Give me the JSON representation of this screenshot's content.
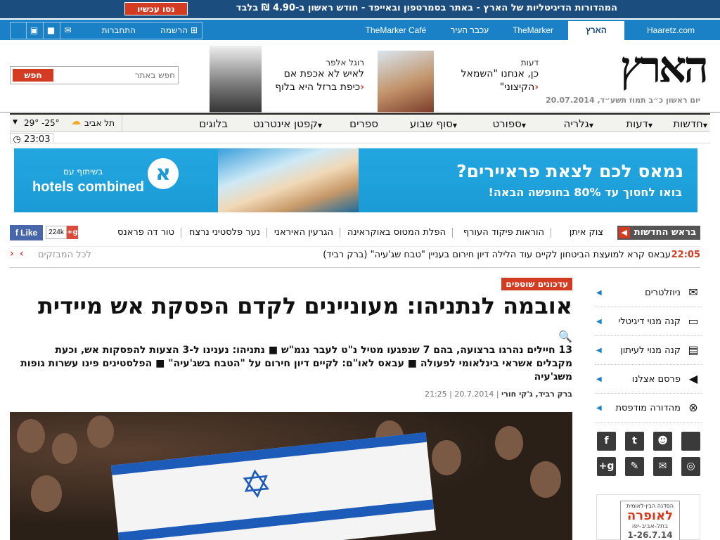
{
  "promo": {
    "text": "המהדורות הדיגיטליות של הארץ - באתר בסמרטפון ובאייפד - חודש ראשון ב-4.90 ₪ בלבד",
    "button": "נסו עכשיו"
  },
  "nav": {
    "sites": [
      "Haaretz.com",
      "הארץ",
      "TheMarker",
      "עכבר העיר",
      "TheMarker Café"
    ],
    "register": "הרשמה",
    "login": "התחברות"
  },
  "header": {
    "logo": "הארץ",
    "date": "יום ראשון כ״ב תמוז תשע״ד, 20.07.2014",
    "teaser1": {
      "category": "דעות",
      "title_line1": "כן, אנחנו \"השמאל",
      "title_line2": "הקיצוני\""
    },
    "teaser2": {
      "category": "רוגל אלפר",
      "title_line1": "לאיש לא אכפת אם",
      "title_line2": "כיפת ברזל היא בלוף"
    },
    "search_placeholder": "חפש באתר",
    "search_button": "חפש"
  },
  "menu": {
    "items": [
      "חדשות",
      "דעות",
      "גלריה",
      "ספורט",
      "סוף שבוע",
      "ספרים",
      "קפטן אינטרנט",
      "בלוגים"
    ],
    "weather_city": "תל אביב",
    "weather_temp": "29° -25°",
    "time": "23:03"
  },
  "banner": {
    "headline": "נמאס לכם לצאת פראיירים?",
    "subline": "בואו לחסוך עד 80% בחופשה הבאה!",
    "brand": "hotels combined",
    "partner": "בשיתוף עם",
    "logo_letter": "א"
  },
  "breaking": {
    "label": "בראש החדשות",
    "topics": [
      "צוק איתן",
      "הוראות פיקוד העורף",
      "הפלת המטוס באוקראינה",
      "הגרעין האיראני",
      "נער פלסטיני נרצח",
      "טור דה פראנס"
    ],
    "like": "Like",
    "gplus_count": "224k",
    "gplus": "g+"
  },
  "ticker": {
    "time": "22:05",
    "text": "עבאס קרא למועצת הביטחון לקיים עוד הלילה דיון חירום בעניין \"טבח שג'עיה\" (ברק רביד)",
    "all": "לכל המבזקים"
  },
  "article": {
    "tag": "עדכונים שוטפים",
    "headline": "אובמה לנתניהו: מעוניינים לקדם הפסקת אש מיידית",
    "subhead": "13 חיילים נהרגו ברצועה, בהם 7 שנפגעו מטיל נ\"ט לעבר נגמ\"ש ■ נתניהו: נענינו ל-3 הצעות להפסקות אש, וכעת מקבלים אשראי בינלאומי לפעולה ■ עבאס לאו\"ם: לקיים דיון חירום על \"הטבח בשג'עיה\" ■ הפלסטינים פינו עשרות גופות משג'עיה",
    "authors": "ברק רביד, ג'קי חורי",
    "date": "20.7.2014",
    "time": "21:25"
  },
  "sidebar": {
    "items": [
      {
        "label": "ניוזלטרים",
        "icon": "envelope-icon"
      },
      {
        "label": "קנה מנוי דיגיטלי",
        "icon": "monitor-icon"
      },
      {
        "label": "קנה מנוי לעיתון",
        "icon": "newspaper-icon"
      },
      {
        "label": "פרסם אצלנו",
        "icon": "megaphone-icon"
      },
      {
        "label": "מהדורה מודפסת",
        "icon": "print-icon"
      }
    ],
    "social": [
      "apple",
      "android",
      "twitter",
      "facebook",
      "rss",
      "email",
      "edit",
      "google-plus"
    ],
    "ad_line1": "הסדנה הבין-לאומית",
    "ad_line2": "לאופרה",
    "ad_line3": "בתל-אביב-יפו",
    "ad_line4": "1-26.7.14"
  },
  "colors": {
    "brand_blue": "#1a81c6",
    "dark_blue": "#1b4d7e",
    "accent_red": "#d33c23"
  }
}
